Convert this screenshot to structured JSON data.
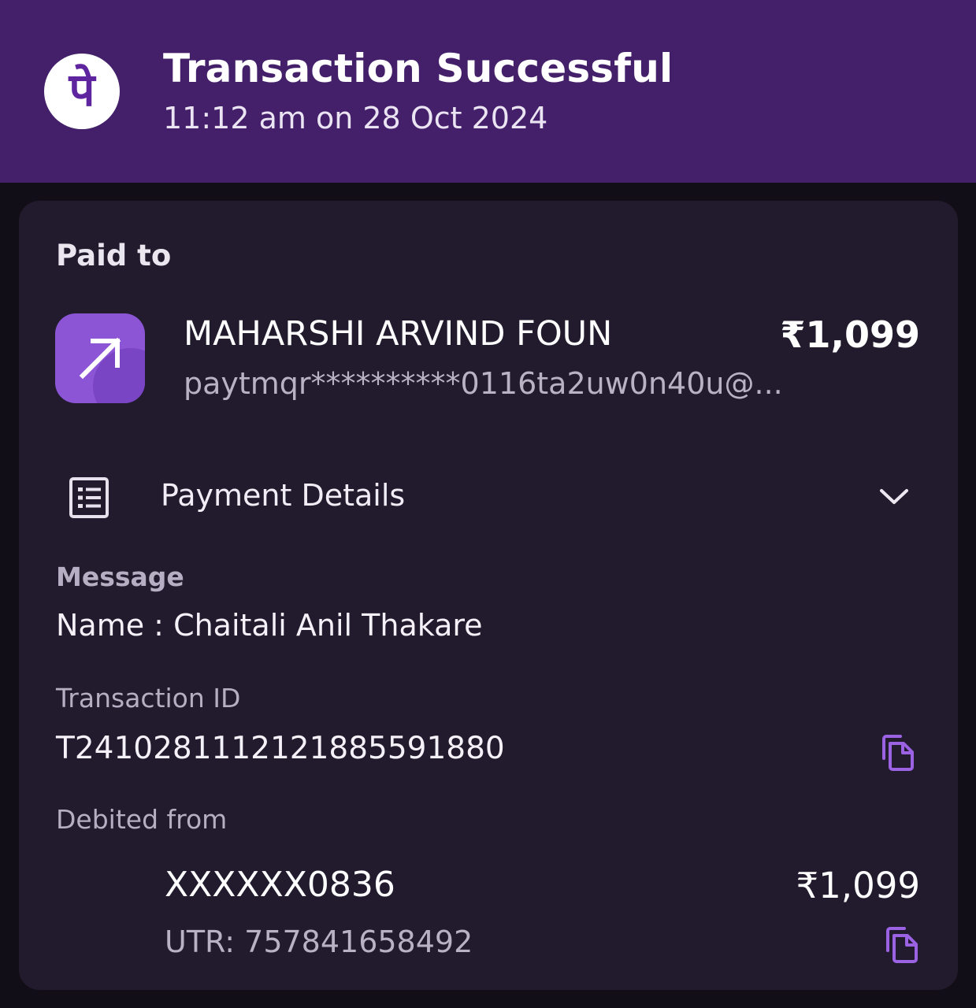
{
  "header": {
    "logo_glyph": "पे",
    "title": "Transaction Successful",
    "timestamp": "11:12 am on 28 Oct 2024"
  },
  "paid_to": {
    "label": "Paid to",
    "merchant_name": "MAHARSHI ARVIND FOUN",
    "upi_id": "paytmqr**********0116ta2uw0n40u@...",
    "amount": "₹1,099",
    "icon": "arrow-up-right-icon"
  },
  "payment_details": {
    "label": "Payment Details",
    "icon": "receipt-list-icon",
    "toggle_icon": "chevron-down-icon"
  },
  "message": {
    "label": "Message",
    "value": "Name : Chaitali Anil Thakare"
  },
  "transaction": {
    "label": "Transaction ID",
    "value": "T2410281112121885591880",
    "copy_icon": "copy-icon"
  },
  "debited_from": {
    "label": "Debited from",
    "account": "XXXXXX0836",
    "amount": "₹1,099",
    "utr": "UTR: 757841658492",
    "copy_icon": "copy-icon"
  },
  "colors": {
    "header_bg": "#44206a",
    "page_bg": "#120e17",
    "card_bg": "#221b2e",
    "accent": "#9b62e3",
    "merchant_icon_bg": "#8c55d6"
  }
}
